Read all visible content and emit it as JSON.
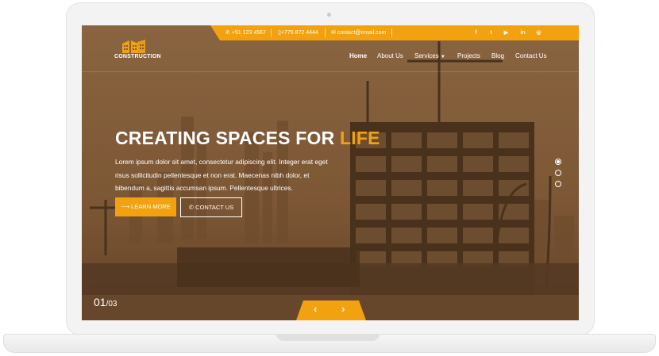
{
  "topbar": {
    "phone1": "+51 123 4567",
    "phone2": "+775 872 4444",
    "email": "contact@email.com",
    "social": [
      "f",
      "t",
      "▶",
      "in",
      "◎"
    ]
  },
  "brand": {
    "name": "CONSTRUCTION"
  },
  "nav": {
    "home": "Home",
    "about": "About Us",
    "services": "Services",
    "projects": "Projects",
    "blog": "Blog",
    "contact": "Contact Us"
  },
  "hero": {
    "title_main": "CREATING SPACES FOR ",
    "title_highlight": "LIFE",
    "text": "Lorem ipsum dolor sit amet, consectetur adipiscing elit. Integer erat eget risus sollicitudin pellentesque et non erat. Maecenas nibh dolor, et bibendum a, sagittis accumsan ipsum. Pellentesque ultrices.",
    "learn_more": "⟶ LEARN MORE",
    "contact_us": "✆ CONTACT US"
  },
  "slider": {
    "current": "01",
    "total": "/03",
    "prev": "‹",
    "next": "›",
    "active_dot": 1
  },
  "colors": {
    "accent": "#f2a20f",
    "overlay": "#7d5a3a"
  }
}
